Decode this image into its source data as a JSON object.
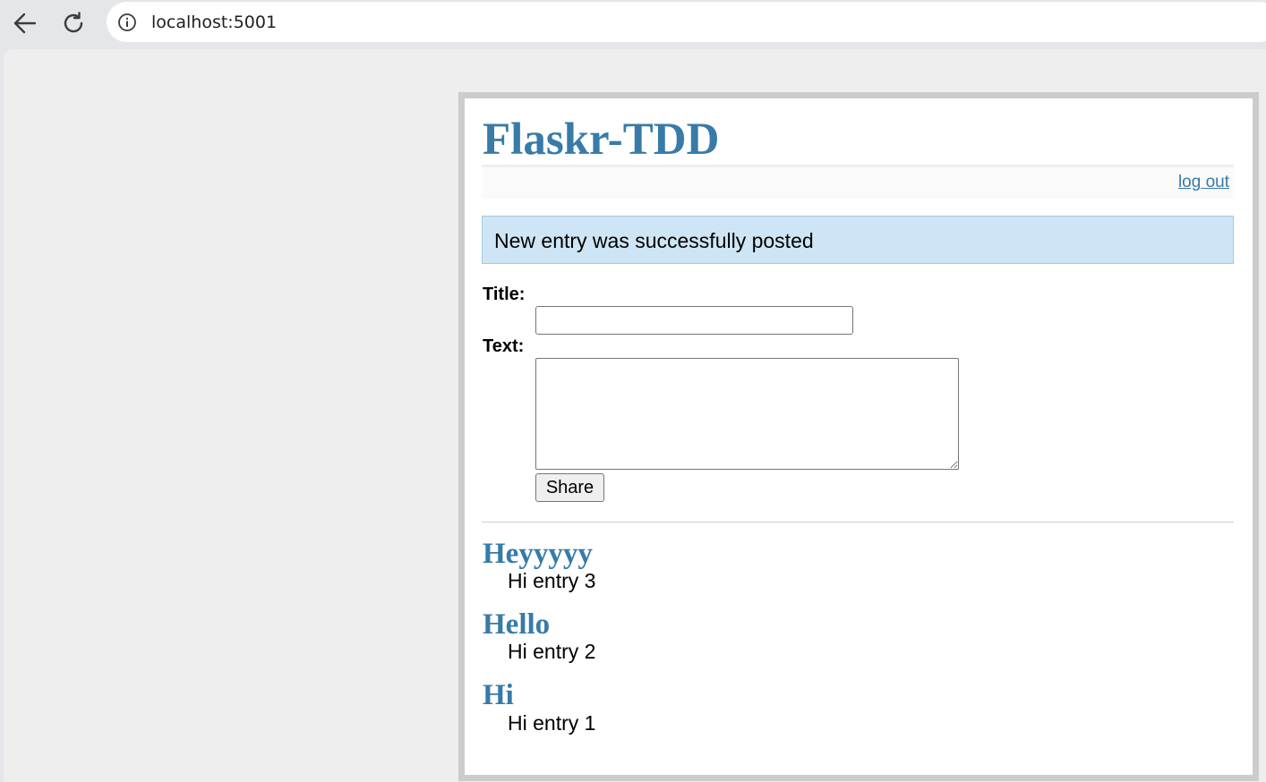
{
  "browser": {
    "url": "localhost:5001"
  },
  "app": {
    "title": "Flaskr-TDD",
    "logout_label": "log out",
    "accent_color": "#377ba8"
  },
  "flash": {
    "message": "New entry was successfully posted"
  },
  "form": {
    "title_label": "Title:",
    "title_value": "",
    "text_label": "Text:",
    "text_value": "",
    "submit_label": "Share"
  },
  "entries": [
    {
      "title": "Heyyyyy",
      "text": "Hi entry 3"
    },
    {
      "title": "Hello",
      "text": "Hi entry 2"
    },
    {
      "title": "Hi",
      "text": "Hi entry 1"
    }
  ]
}
